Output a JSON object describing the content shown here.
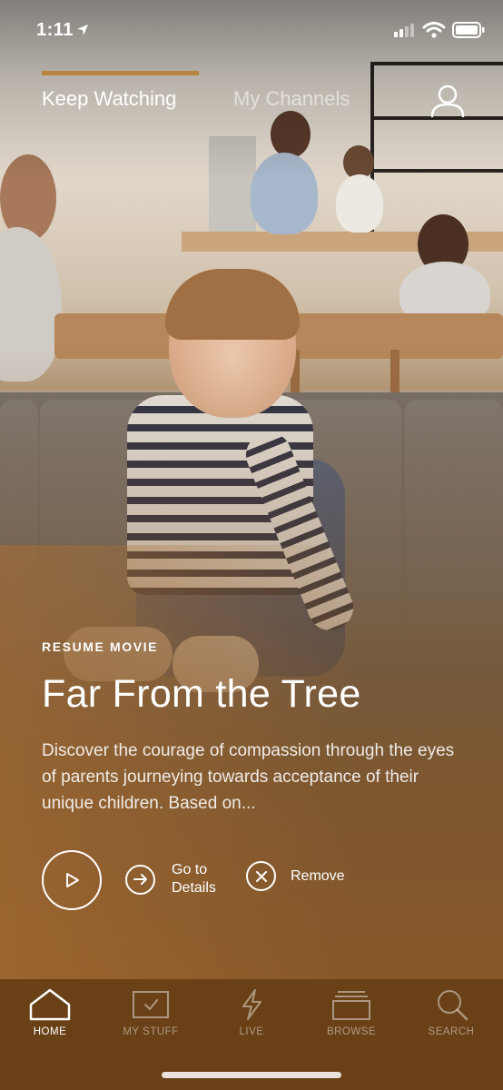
{
  "status_bar": {
    "time": "1:11"
  },
  "top_nav": {
    "tabs": [
      {
        "label": "Keep Watching",
        "active": true
      },
      {
        "label": "My Channels",
        "active": false
      }
    ]
  },
  "hero": {
    "eyebrow": "RESUME MOVIE",
    "title": "Far From the Tree",
    "description": "Discover the courage of compassion through the eyes of parents journeying towards acceptance of their unique children. Based on...",
    "actions": {
      "details_label": "Go to Details",
      "remove_label": "Remove"
    }
  },
  "bottom_tabs": [
    {
      "label": "HOME",
      "icon": "home-icon",
      "active": true
    },
    {
      "label": "MY STUFF",
      "icon": "my-stuff-icon",
      "active": false
    },
    {
      "label": "LIVE",
      "icon": "lightning-icon",
      "active": false
    },
    {
      "label": "BROWSE",
      "icon": "browse-stack-icon",
      "active": false
    },
    {
      "label": "SEARCH",
      "icon": "search-icon",
      "active": false
    }
  ],
  "colors": {
    "accent": "#b8843e",
    "tab_bar": "#6a4117"
  }
}
